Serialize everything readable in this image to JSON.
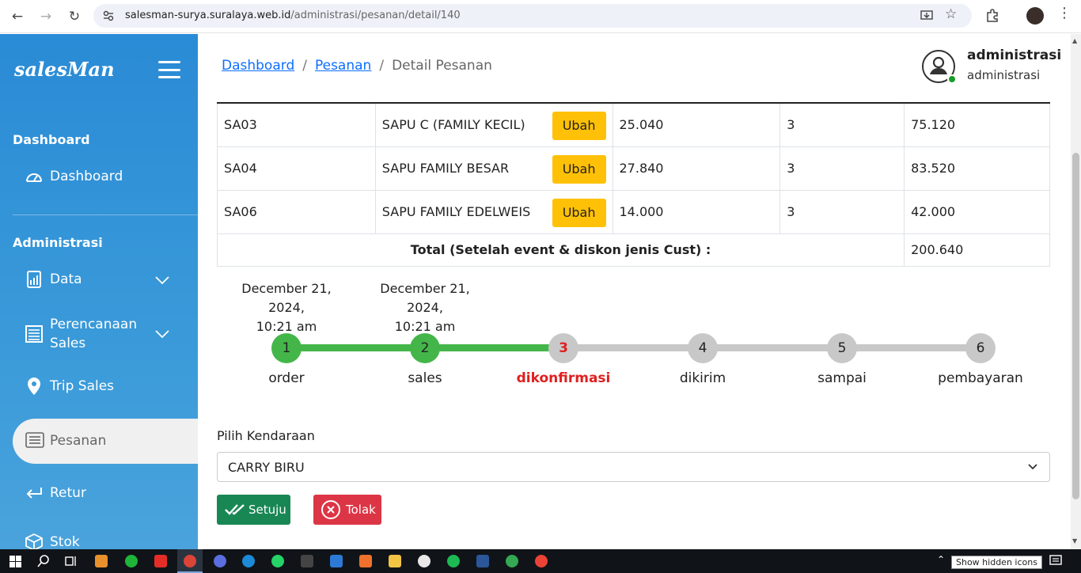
{
  "browser": {
    "url_host": "salesman-surya.suralaya.web.id",
    "url_path": "/administrasi/pesanan/detail/140"
  },
  "sidebar": {
    "logo": "salesMan",
    "section_dashboard": "Dashboard",
    "item_dashboard": "Dashboard",
    "section_admin": "Administrasi",
    "item_data": "Data",
    "item_perencanaan_1": "Perencanaan",
    "item_perencanaan_2": "Sales",
    "item_trip": "Trip Sales",
    "item_pesanan": "Pesanan",
    "item_retur": "Retur",
    "item_stok": "Stok"
  },
  "header": {
    "breadcrumb": [
      "Dashboard",
      "Pesanan",
      "Detail Pesanan"
    ],
    "user_name": "administrasi",
    "user_role": "administrasi"
  },
  "orders": {
    "edit_label": "Ubah",
    "rows": [
      {
        "code": "SA03",
        "product": "SAPU C (FAMILY KECIL)",
        "price": "25.040",
        "qty": "3",
        "subtotal": "75.120"
      },
      {
        "code": "SA04",
        "product": "SAPU FAMILY BESAR",
        "price": "27.840",
        "qty": "3",
        "subtotal": "83.520"
      },
      {
        "code": "SA06",
        "product": "SAPU FAMILY EDELWEIS",
        "price": "14.000",
        "qty": "3",
        "subtotal": "42.000"
      }
    ],
    "total_label": "Total (Setelah event & diskon jenis Cust) :",
    "total_value": "200.640"
  },
  "timeline": {
    "timestamps": [
      {
        "date": "December 21, 2024,",
        "time": "10:21 am"
      },
      {
        "date": "December 21, 2024,",
        "time": "10:21 am"
      }
    ],
    "steps": [
      {
        "num": "1",
        "label": "order",
        "state": "done"
      },
      {
        "num": "2",
        "label": "sales",
        "state": "done"
      },
      {
        "num": "3",
        "label": "dikonfirmasi",
        "state": "current"
      },
      {
        "num": "4",
        "label": "dikirim",
        "state": "pending"
      },
      {
        "num": "5",
        "label": "sampai",
        "state": "pending"
      },
      {
        "num": "6",
        "label": "pembayaran",
        "state": "pending"
      }
    ]
  },
  "form": {
    "vehicle_label": "Pilih Kendaraan",
    "vehicle_value": "CARRY BIRU",
    "approve_label": "Setuju",
    "reject_label": "Tolak"
  },
  "taskbar": {
    "tooltip": "Show hidden icons"
  },
  "colors": {
    "sidebar": "#2a8bd6",
    "success": "#44b649",
    "warning": "#ffc107",
    "danger": "#dc3545",
    "approve": "#198754"
  }
}
